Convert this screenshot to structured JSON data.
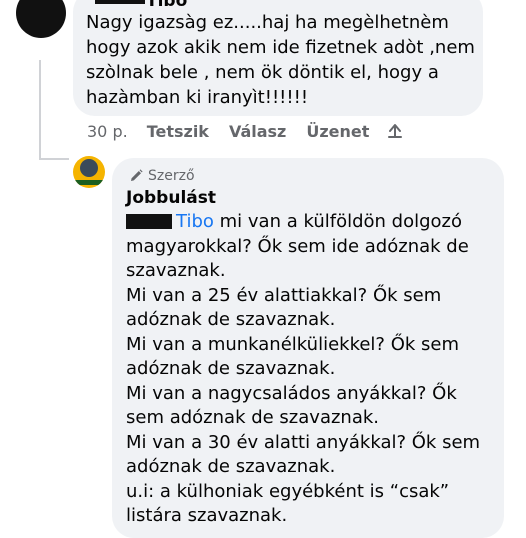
{
  "top_comment": {
    "author": "Tibo",
    "text": "Nagy igazsàg ez.....haj ha megèlhetnèm hogy azok akik nem ide fizetnek adòt ,nem szòlnak bele , nem ök döntik el, hogy a hazàmban ki iranyìt!!!!!!",
    "time": "30 p.",
    "actions": {
      "like": "Tetszik",
      "reply": "Válasz",
      "message": "Üzenet"
    }
  },
  "reply": {
    "badge": "Szerző",
    "author": "Jobbulást",
    "mention": "Tibo",
    "first_line": "mi van a külföldön dolgozó magyarokkal? Ők sem ide adóznak de szavaznak.",
    "lines": [
      "Mi van a 25 év alattiakkal? Ők sem adóznak de szavaznak.",
      "Mi van a munkanélküliekkel? Ők sem adóznak de szavaznak.",
      "Mi van a nagycsaládos anyákkal? Ők sem adóznak de szavaznak.",
      "Mi van a 30 év alatti anyákkal? Ők sem adóznak de szavaznak.",
      "u.i: a külhoniak egyébként is “csak” listára szavaznak."
    ]
  },
  "colors": {
    "bubble": "#f0f2f5",
    "link": "#1877f2",
    "muted": "#65676b"
  },
  "icons": {
    "share": "share-arrow-icon",
    "author": "pencil-icon"
  }
}
